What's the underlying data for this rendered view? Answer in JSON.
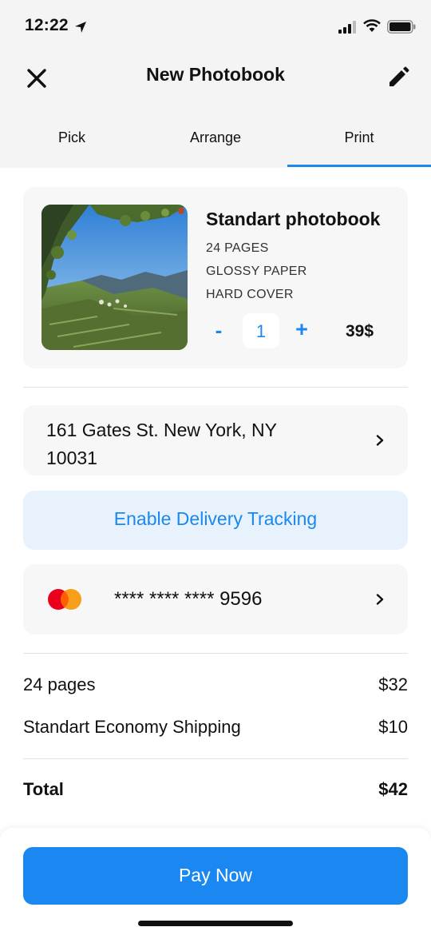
{
  "status_bar": {
    "time": "12:22"
  },
  "header": {
    "title": "New Photobook",
    "close_icon": "close-icon",
    "edit_icon": "pencil-icon"
  },
  "tabs": [
    {
      "label": "Pick",
      "active": false
    },
    {
      "label": "Arrange",
      "active": false
    },
    {
      "label": "Print",
      "active": true
    }
  ],
  "product": {
    "title": "Standart photobook",
    "specs": [
      "24 PAGES",
      "GLOSSY PAPER",
      "HARD COVER"
    ],
    "quantity": "1",
    "minus": "-",
    "plus": "+",
    "price": "39$"
  },
  "address": {
    "lines": [
      "161 Gates St. New York, NY",
      "10031"
    ]
  },
  "tracking": {
    "label": "Enable Delivery Tracking"
  },
  "payment": {
    "card_number": "**** **** **** 9596",
    "brand_icon": "mastercard-icon"
  },
  "summary": {
    "rows": [
      {
        "label": "24 pages",
        "value": "$32"
      },
      {
        "label": "Standart Economy Shipping",
        "value": "$10"
      }
    ],
    "total_label": "Total",
    "total_value": "$42"
  },
  "pay_button": {
    "label": "Pay Now"
  },
  "colors": {
    "accent": "#1a88f0",
    "tracking_bg": "#e8f2fd",
    "card_bg": "#f7f7f7",
    "header_bg": "#f4f4f4"
  }
}
